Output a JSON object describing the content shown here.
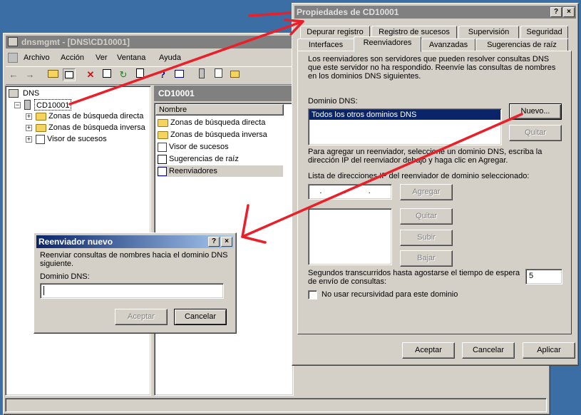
{
  "mmc": {
    "title": "dnsmgmt - [DNS\\CD10001]",
    "menu": [
      "Archivo",
      "Acción",
      "Ver",
      "Ventana",
      "Ayuda"
    ],
    "tree": {
      "root": "DNS",
      "server": "CD10001",
      "children": [
        "Zonas de búsqueda directa",
        "Zonas de búsqueda inversa",
        "Visor de sucesos"
      ]
    },
    "right_header": "CD10001",
    "column_name": "Nombre",
    "list_items": [
      "Zonas de búsqueda directa",
      "Zonas de búsqueda inversa",
      "Visor de sucesos",
      "Sugerencias de raíz",
      "Reenviadores"
    ]
  },
  "props": {
    "title": "Propiedades de CD10001",
    "help_btn": "?",
    "close_btn": "×",
    "tabs_row1": [
      "Depurar registro",
      "Registro de sucesos",
      "Supervisión",
      "Seguridad"
    ],
    "tabs_row2": [
      "Interfaces",
      "Reenviadores",
      "Avanzadas",
      "Sugerencias de raíz"
    ],
    "description": "Los reenviadores son servidores que pueden resolver consultas DNS que este servidor no ha respondido. Reenvíe las consultas de nombres en los dominios DNS siguientes.",
    "domain_label": "Dominio DNS:",
    "domain_item": "Todos los otros dominios DNS",
    "new_button": "Nuevo...",
    "remove_button": "Quitar",
    "add_instructions": "Para agregar un reenviador, seleccione un dominio DNS, escriba la dirección IP del reenviador debajo y haga clic en Agregar.",
    "ip_list_label": "Lista de direcciones IP del reenviador de dominio seleccionado:",
    "ip_dots": ". . .",
    "add_button": "Agregar",
    "remove2_button": "Quitar",
    "up_button": "Subir",
    "down_button": "Bajar",
    "timeout_label": "Segundos transcurridos hasta agostarse el tiempo de espera de envío de consultas:",
    "timeout_value": "5",
    "no_recursion_label": "No usar recursividad para este dominio",
    "ok_button": "Aceptar",
    "cancel_button": "Cancelar",
    "apply_button": "Aplicar"
  },
  "newfwd": {
    "title": "Reenviador nuevo",
    "help_btn": "?",
    "close_btn": "×",
    "description": "Reenviar consultas de nombres hacia el dominio DNS siguiente.",
    "domain_label": "Dominio DNS:",
    "domain_value": "",
    "ok_button": "Aceptar",
    "cancel_button": "Cancelar"
  },
  "colors": {
    "desktop": "#3a6ea5",
    "window": "#d4d0c8",
    "active_title": "#0a246a",
    "selection": "#0a246a",
    "arrow": "#e8202a"
  }
}
